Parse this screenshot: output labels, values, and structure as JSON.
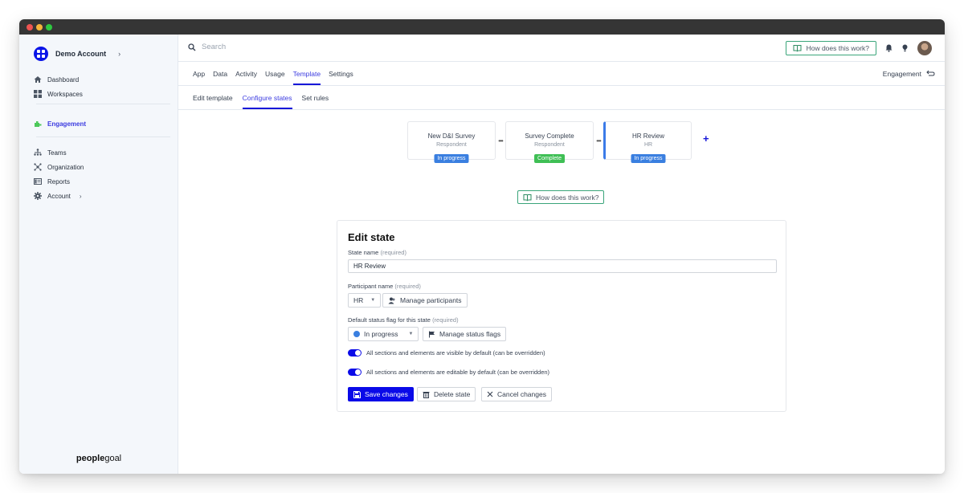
{
  "sidebar": {
    "account_name": "Demo Account",
    "items_top": [
      {
        "label": "Dashboard",
        "icon": "home-icon"
      },
      {
        "label": "Workspaces",
        "icon": "grid-icon"
      }
    ],
    "active_item": {
      "label": "Engagement",
      "icon": "puzzle-icon"
    },
    "items_bottom": [
      {
        "label": "Teams",
        "icon": "teams-icon"
      },
      {
        "label": "Organization",
        "icon": "organization-icon"
      },
      {
        "label": "Reports",
        "icon": "reports-icon"
      },
      {
        "label": "Account",
        "icon": "gear-icon"
      }
    ],
    "brand_bold": "people",
    "brand_light": "goal"
  },
  "topbar": {
    "search_placeholder": "Search",
    "help_label": "How does this work?"
  },
  "tabs": {
    "primary": [
      "App",
      "Data",
      "Activity",
      "Usage",
      "Template",
      "Settings"
    ],
    "primary_active": "Template",
    "secondary": [
      "Edit template",
      "Configure states",
      "Set rules"
    ],
    "secondary_active": "Configure states",
    "context_label": "Engagement"
  },
  "states": [
    {
      "name": "New D&I Survey",
      "role": "Respondent",
      "status": "In progress",
      "status_color": "#3a7fe0"
    },
    {
      "name": "Survey Complete",
      "role": "Respondent",
      "status": "Complete",
      "status_color": "#3fbf55"
    },
    {
      "name": "HR Review",
      "role": "HR",
      "status": "In progress",
      "status_color": "#3a7fe0",
      "selected": true
    }
  ],
  "help_label": "How does this work?",
  "edit_state": {
    "title": "Edit state",
    "state_name_label": "State name",
    "required": "(required)",
    "state_name_value": "HR Review",
    "participant_label": "Participant name",
    "participant_value": "HR",
    "manage_participants": "Manage participants",
    "status_flag_label": "Default status flag for this state",
    "status_flag_value": "In progress",
    "manage_status_flags": "Manage status flags",
    "toggle_visible_label": "All sections and elements are visible by default (can be overridden)",
    "toggle_visible_on": true,
    "toggle_editable_label": "All sections and elements are editable by default (can be overridden)",
    "toggle_editable_on": true,
    "save_label": "Save changes",
    "delete_label": "Delete state",
    "cancel_label": "Cancel changes"
  },
  "colors": {
    "accent": "#0a0ae8",
    "active_tab": "#3b3be0",
    "help_border": "#3aa57a"
  }
}
